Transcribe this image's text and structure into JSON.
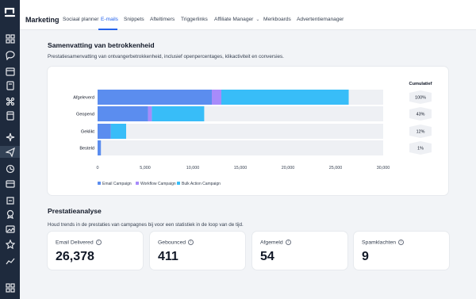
{
  "nav_rail": {
    "logo": "logo-icon",
    "icons": [
      "dashboard-icon",
      "conversations-icon",
      "calendar-icon",
      "contacts-icon",
      "opportunities-icon",
      "payments-icon",
      "ai-agents-icon",
      "marketing-icon",
      "automation-icon",
      "sites-icon",
      "memberships-icon",
      "media-icon",
      "reputation-icon",
      "reporting-icon",
      "app-marketplace-icon",
      "settings-icon"
    ]
  },
  "header": {
    "title": "Marketing",
    "tabs": [
      "Sociaal planner",
      "E-mails",
      "Snippets",
      "Afteltimers",
      "Triggerlinks",
      "Affiliate Manager",
      "Merkboards",
      "Advertentiemanager"
    ],
    "active_tab": "E-mails"
  },
  "summary": {
    "title": "Samenvatting van betrokkenheid",
    "subtitle": "Prestatiesamenvatting van ontvangerbetrokkenheid, inclusief openpercentages, klikactiviteit en conversies."
  },
  "chart_data": {
    "type": "bar",
    "orientation": "horizontal",
    "stacked": true,
    "categories": [
      "Afgeleverd",
      "Geopend",
      "Geklikt",
      "Besteld"
    ],
    "series": [
      {
        "name": "Email Campaign",
        "color": "#5b8def",
        "values": [
          12000,
          5300,
          1400,
          350
        ]
      },
      {
        "name": "Workflow Campaign",
        "color": "#a78bfa",
        "values": [
          1000,
          400,
          0,
          0
        ]
      },
      {
        "name": "Bulk Action Campaign",
        "color": "#38bdf8",
        "values": [
          13378,
          5500,
          1600,
          0
        ]
      }
    ],
    "xlim": [
      0,
      30000
    ],
    "xticks": [
      "0",
      "5,000",
      "10,000",
      "15,000",
      "20,000",
      "25,000",
      "30,000"
    ],
    "cumulative_label": "Cumulatief",
    "cumulative": [
      "100%",
      "43%",
      "12%",
      "1%"
    ],
    "legend_position": "bottom-left",
    "track_color": "#eef0f4"
  },
  "performance": {
    "title": "Prestatieanalyse",
    "subtitle": "Houd trends in de prestaties van campagnes bij voor een statistiek in de loop van de tijd.",
    "stats": [
      {
        "label": "Email Delivered",
        "value": "26,378"
      },
      {
        "label": "Gebounced",
        "value": "411"
      },
      {
        "label": "Afgemeld",
        "value": "54"
      },
      {
        "label": "Spamklachten",
        "value": "9"
      }
    ],
    "info_glyph": "i"
  }
}
